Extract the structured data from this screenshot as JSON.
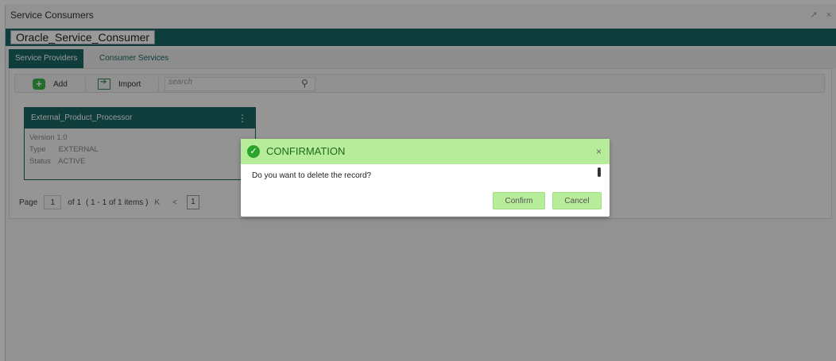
{
  "window": {
    "title": "Service Consumers",
    "controls": "↗ ×"
  },
  "consumer": {
    "name": "Oracle_Service_Consumer"
  },
  "tabs": [
    {
      "label": "Service Providers",
      "active": true
    },
    {
      "label": "Consumer Services",
      "active": false
    }
  ],
  "toolbar": {
    "add_label": "Add",
    "import_label": "Import",
    "search_placeholder": "search"
  },
  "card": {
    "name": "External_Product_Processor",
    "menu_icon": "⋮",
    "version_label": "Version",
    "version_value": "1.0",
    "type_label": "Type",
    "type_value": "EXTERNAL",
    "status_label": "Status",
    "status_value": "ACTIVE"
  },
  "pager": {
    "page_label": "Page",
    "page_value": "1",
    "of_label": "of 1",
    "summary": "( 1 - 1 of 1 items )",
    "first_btn": "K",
    "prev_btn": "<",
    "current": "1"
  },
  "dialog": {
    "title": "CONFIRMATION",
    "close": "×",
    "message": "Do you want to delete the record?",
    "confirm_label": "Confirm",
    "cancel_label": "Cancel"
  },
  "colors": {
    "brand": "#186663",
    "success_bg": "#b7ec9a",
    "success_icon": "#2aa52a"
  }
}
